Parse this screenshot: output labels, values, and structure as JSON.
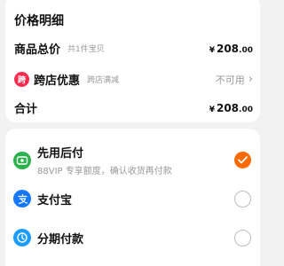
{
  "price_detail": {
    "title": "价格明细",
    "total_goods": {
      "label": "商品总价",
      "note": "共1件宝贝",
      "currency": "¥",
      "integer": "208",
      "decimal": ".00"
    },
    "cross_store": {
      "badge": "跨",
      "label": "跨店优惠",
      "note": "跨店满减",
      "value": "不可用",
      "chevron": "›"
    },
    "subtotal": {
      "label": "合计",
      "currency": "¥",
      "integer": "208",
      "decimal": ".00"
    }
  },
  "payment_methods": [
    {
      "label": "先用后付",
      "desc": "88VIP 专享额度，确认收货再付款",
      "icon": "pay-later-icon",
      "color": "#2bb24c",
      "selected": true
    },
    {
      "label": "支付宝",
      "icon": "alipay-icon",
      "color": "#1677ff",
      "selected": false
    },
    {
      "label": "分期付款",
      "icon": "installment-icon",
      "color": "#1a9dff",
      "selected": false
    }
  ],
  "colors": {
    "accent": "#ff6a00",
    "badge_red": "#ff2c4f"
  }
}
